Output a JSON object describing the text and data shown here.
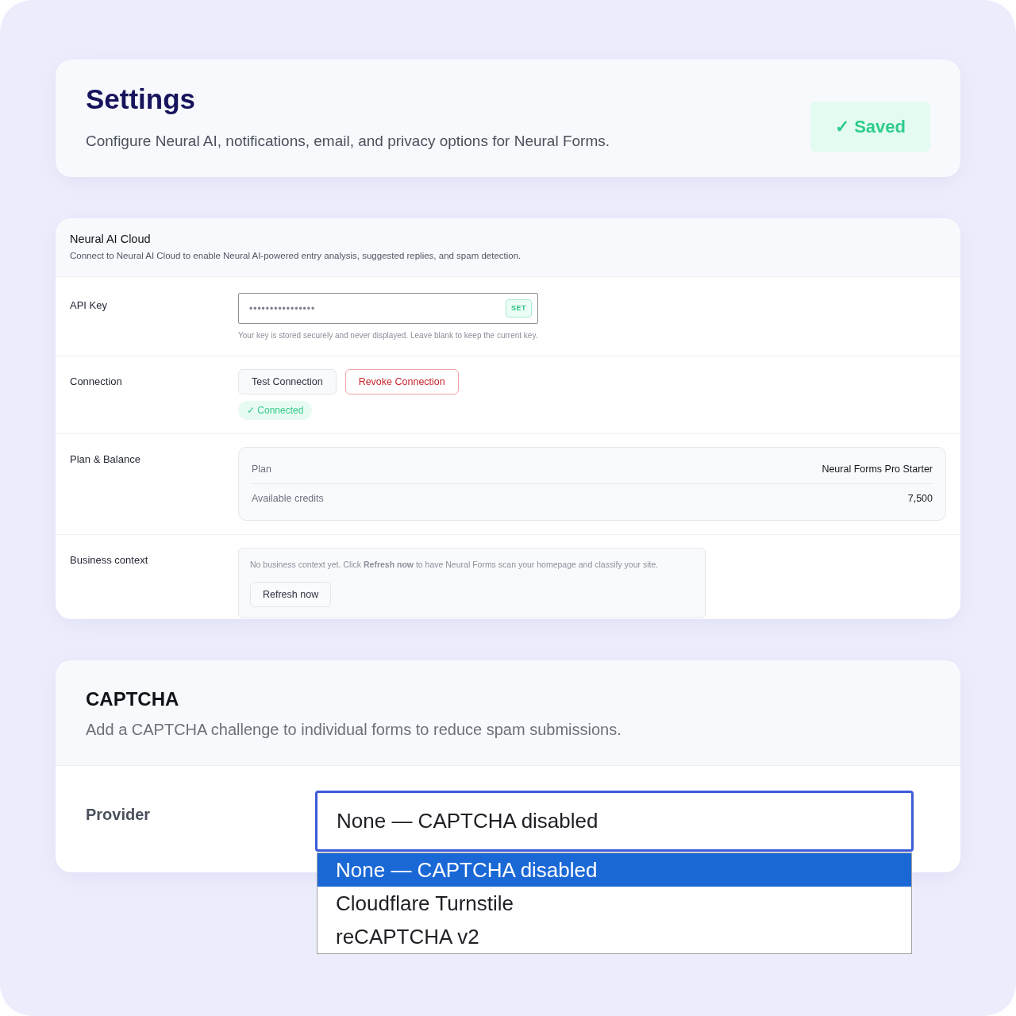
{
  "header": {
    "title": "Settings",
    "subtitle": "Configure Neural AI, notifications, email, and privacy options for Neural Forms.",
    "status_badge": {
      "label": "✓ Saved"
    }
  },
  "neural_ai_cloud": {
    "title": "Neural AI Cloud",
    "description": "Connect to Neural AI Cloud to enable Neural AI-powered entry analysis, suggested replies, and spam detection.",
    "rows": [
      {
        "kind": "api_key",
        "label": "API Key",
        "field": {
          "placeholder": "••••••••••••••••",
          "badge": "SET"
        },
        "help": "Your key is stored securely and never displayed. Leave blank to keep the current key."
      },
      {
        "kind": "connection",
        "label": "Connection",
        "buttons": [
          {
            "label": "Test Connection",
            "kind": "default"
          },
          {
            "label": "Revoke Connection",
            "kind": "danger"
          }
        ],
        "status": {
          "label": "✓ Connected"
        }
      },
      {
        "kind": "plan",
        "label": "Plan & Balance",
        "items": [
          {
            "label": "Plan",
            "value": "Neural Forms Pro Starter"
          },
          {
            "label": "Available credits",
            "value": "7,500"
          }
        ]
      },
      {
        "kind": "business_context",
        "label": "Business context",
        "message": "No business context yet. Click **Refresh now** to have Neural Forms scan your homepage and classify your site.",
        "button": "Refresh now"
      }
    ]
  },
  "captcha": {
    "title": "CAPTCHA",
    "description": "Add a CAPTCHA challenge to individual forms to reduce spam submissions.",
    "provider": {
      "label": "Provider",
      "value": "None — CAPTCHA disabled",
      "expanded": true,
      "options": [
        {
          "label": "None — CAPTCHA disabled",
          "selected": true
        },
        {
          "label": "Cloudflare Turnstile",
          "selected": false
        },
        {
          "label": "reCAPTCHA v2",
          "selected": false
        }
      ]
    }
  }
}
